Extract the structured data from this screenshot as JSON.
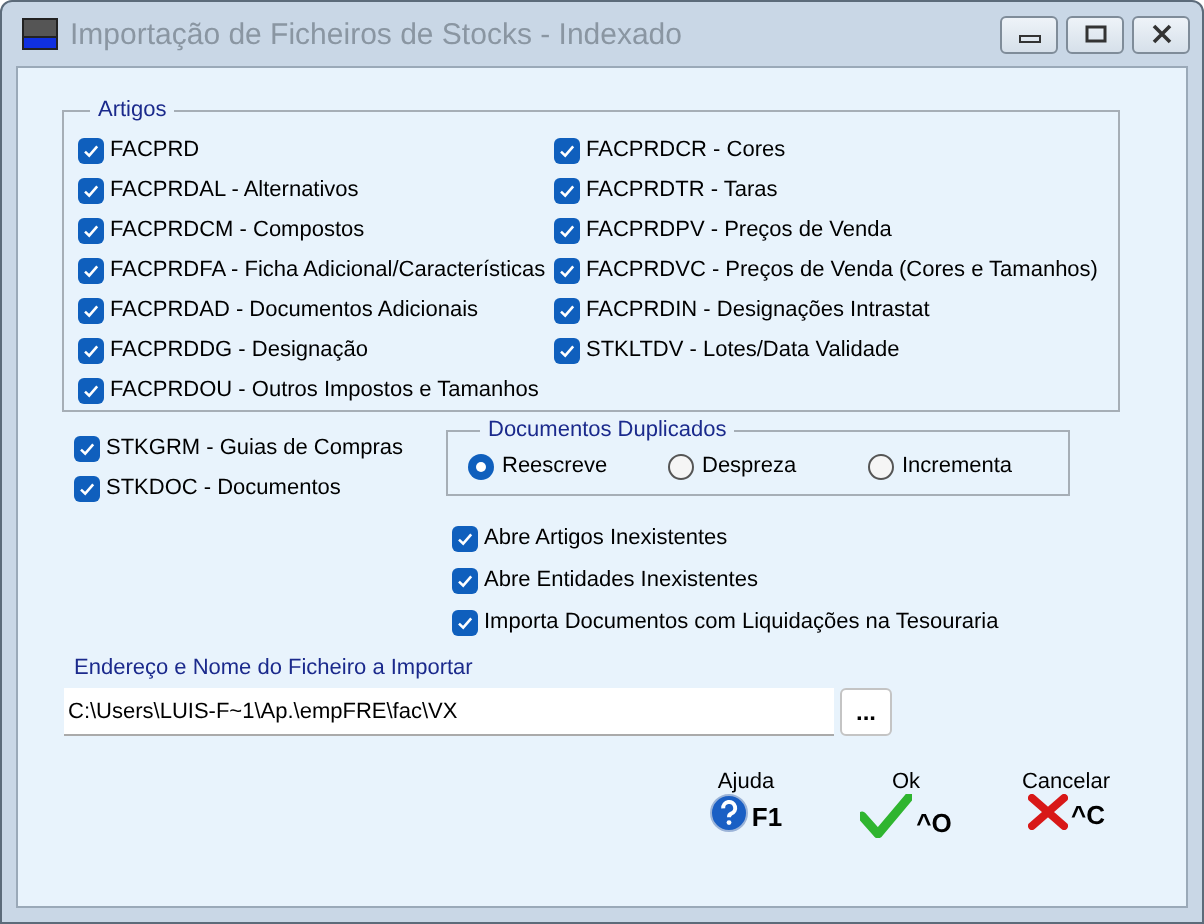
{
  "window": {
    "title": "Importação de Ficheiros de Stocks - Indexado"
  },
  "artigos": {
    "title": "Artigos",
    "columns": [
      [
        {
          "label": "FACPRD",
          "checked": true
        },
        {
          "label": "FACPRDAL - Alternativos",
          "checked": true
        },
        {
          "label": "FACPRDCM - Compostos",
          "checked": true
        },
        {
          "label": "FACPRDFA - Ficha Adicional/Características",
          "checked": true
        },
        {
          "label": "FACPRDAD - Documentos Adicionais",
          "checked": true
        },
        {
          "label": "FACPRDDG - Designação",
          "checked": true
        },
        {
          "label": "FACPRDOU - Outros Impostos e Tamanhos",
          "checked": true
        }
      ],
      [
        {
          "label": "FACPRDCR - Cores",
          "checked": true
        },
        {
          "label": "FACPRDTR - Taras",
          "checked": true
        },
        {
          "label": "FACPRDPV - Preços de Venda",
          "checked": true
        },
        {
          "label": "FACPRDVC - Preços de Venda (Cores e Tamanhos)",
          "checked": true
        },
        {
          "label": "FACPRDIN - Designações Intrastat",
          "checked": true
        },
        {
          "label": "STKLTDV - Lotes/Data Validade",
          "checked": true
        }
      ]
    ]
  },
  "documents": [
    {
      "label": "STKGRM - Guias de Compras",
      "checked": true
    },
    {
      "label": "STKDOC - Documentos",
      "checked": true
    }
  ],
  "duplicates": {
    "title": "Documentos Duplicados",
    "options": [
      {
        "label": "Reescreve",
        "selected": true
      },
      {
        "label": "Despreza",
        "selected": false
      },
      {
        "label": "Incrementa",
        "selected": false
      }
    ]
  },
  "options": [
    {
      "label": "Abre Artigos Inexistentes",
      "checked": true
    },
    {
      "label": "Abre Entidades Inexistentes",
      "checked": true
    },
    {
      "label": "Importa Documentos com Liquidações na Tesouraria",
      "checked": true
    }
  ],
  "file": {
    "label": "Endereço e Nome do Ficheiro a Importar",
    "value": "C:\\Users\\LUIS-F~1\\Ap.\\empFRE\\fac\\VX",
    "browse": "..."
  },
  "buttons": [
    {
      "kind": "help",
      "label": "Ajuda",
      "shortcut": "F1"
    },
    {
      "kind": "ok",
      "label": "Ok",
      "shortcut": "^O"
    },
    {
      "kind": "cancel",
      "label": "Cancelar",
      "shortcut": "^C"
    }
  ]
}
